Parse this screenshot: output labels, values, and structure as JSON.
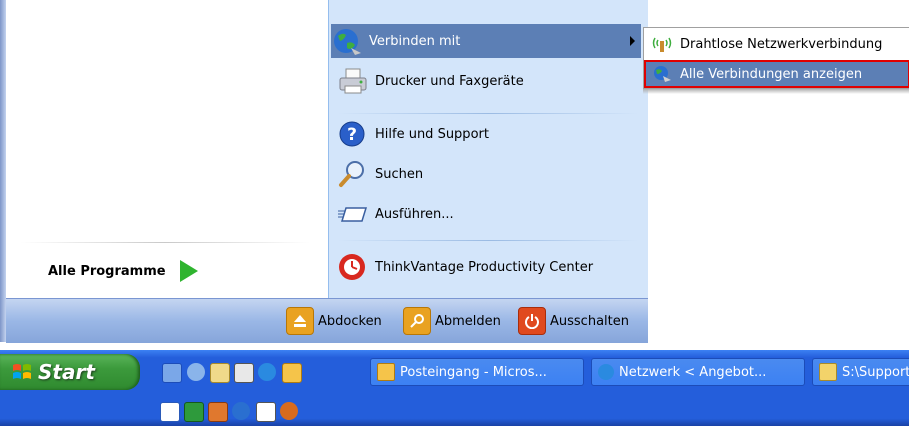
{
  "start_menu": {
    "all_programs_label": "Alle Programme",
    "items": [
      {
        "label": "Verbinden mit",
        "icon": "globe-network-icon",
        "has_submenu": true
      },
      {
        "label": "Drucker und Faxgeräte",
        "icon": "printer-icon"
      },
      {
        "label": "Hilfe und Support",
        "icon": "help-icon"
      },
      {
        "label": "Suchen",
        "icon": "search-icon"
      },
      {
        "label": "Ausführen...",
        "icon": "run-icon"
      },
      {
        "label": "ThinkVantage Productivity Center",
        "icon": "thinkvantage-icon"
      }
    ],
    "bottom_buttons": [
      {
        "label": "Abdocken",
        "icon": "eject-icon"
      },
      {
        "label": "Abmelden",
        "icon": "logoff-key-icon"
      },
      {
        "label": "Ausschalten",
        "icon": "power-icon"
      }
    ]
  },
  "submenu": {
    "items": [
      {
        "label": "Drahtlose Netzwerkverbindung",
        "icon": "wireless-network-icon"
      },
      {
        "label": "Alle Verbindungen anzeigen",
        "icon": "network-connections-icon"
      }
    ]
  },
  "taskbar": {
    "start_label": "Start",
    "tasks": [
      {
        "label": "Posteingang - Micros...",
        "icon": "outlook-icon"
      },
      {
        "label": "Netzwerk < Angebot...",
        "icon": "internet-explorer-icon"
      },
      {
        "label": "S:\\Support",
        "icon": "folder-icon"
      }
    ]
  },
  "colors": {
    "menu_highlight": "#5c7fb5",
    "right_pane_bg": "#d3e5fa",
    "taskbar_blue": "#245edb",
    "start_green": "#3c9a3c",
    "annotation_red": "#e00000"
  }
}
